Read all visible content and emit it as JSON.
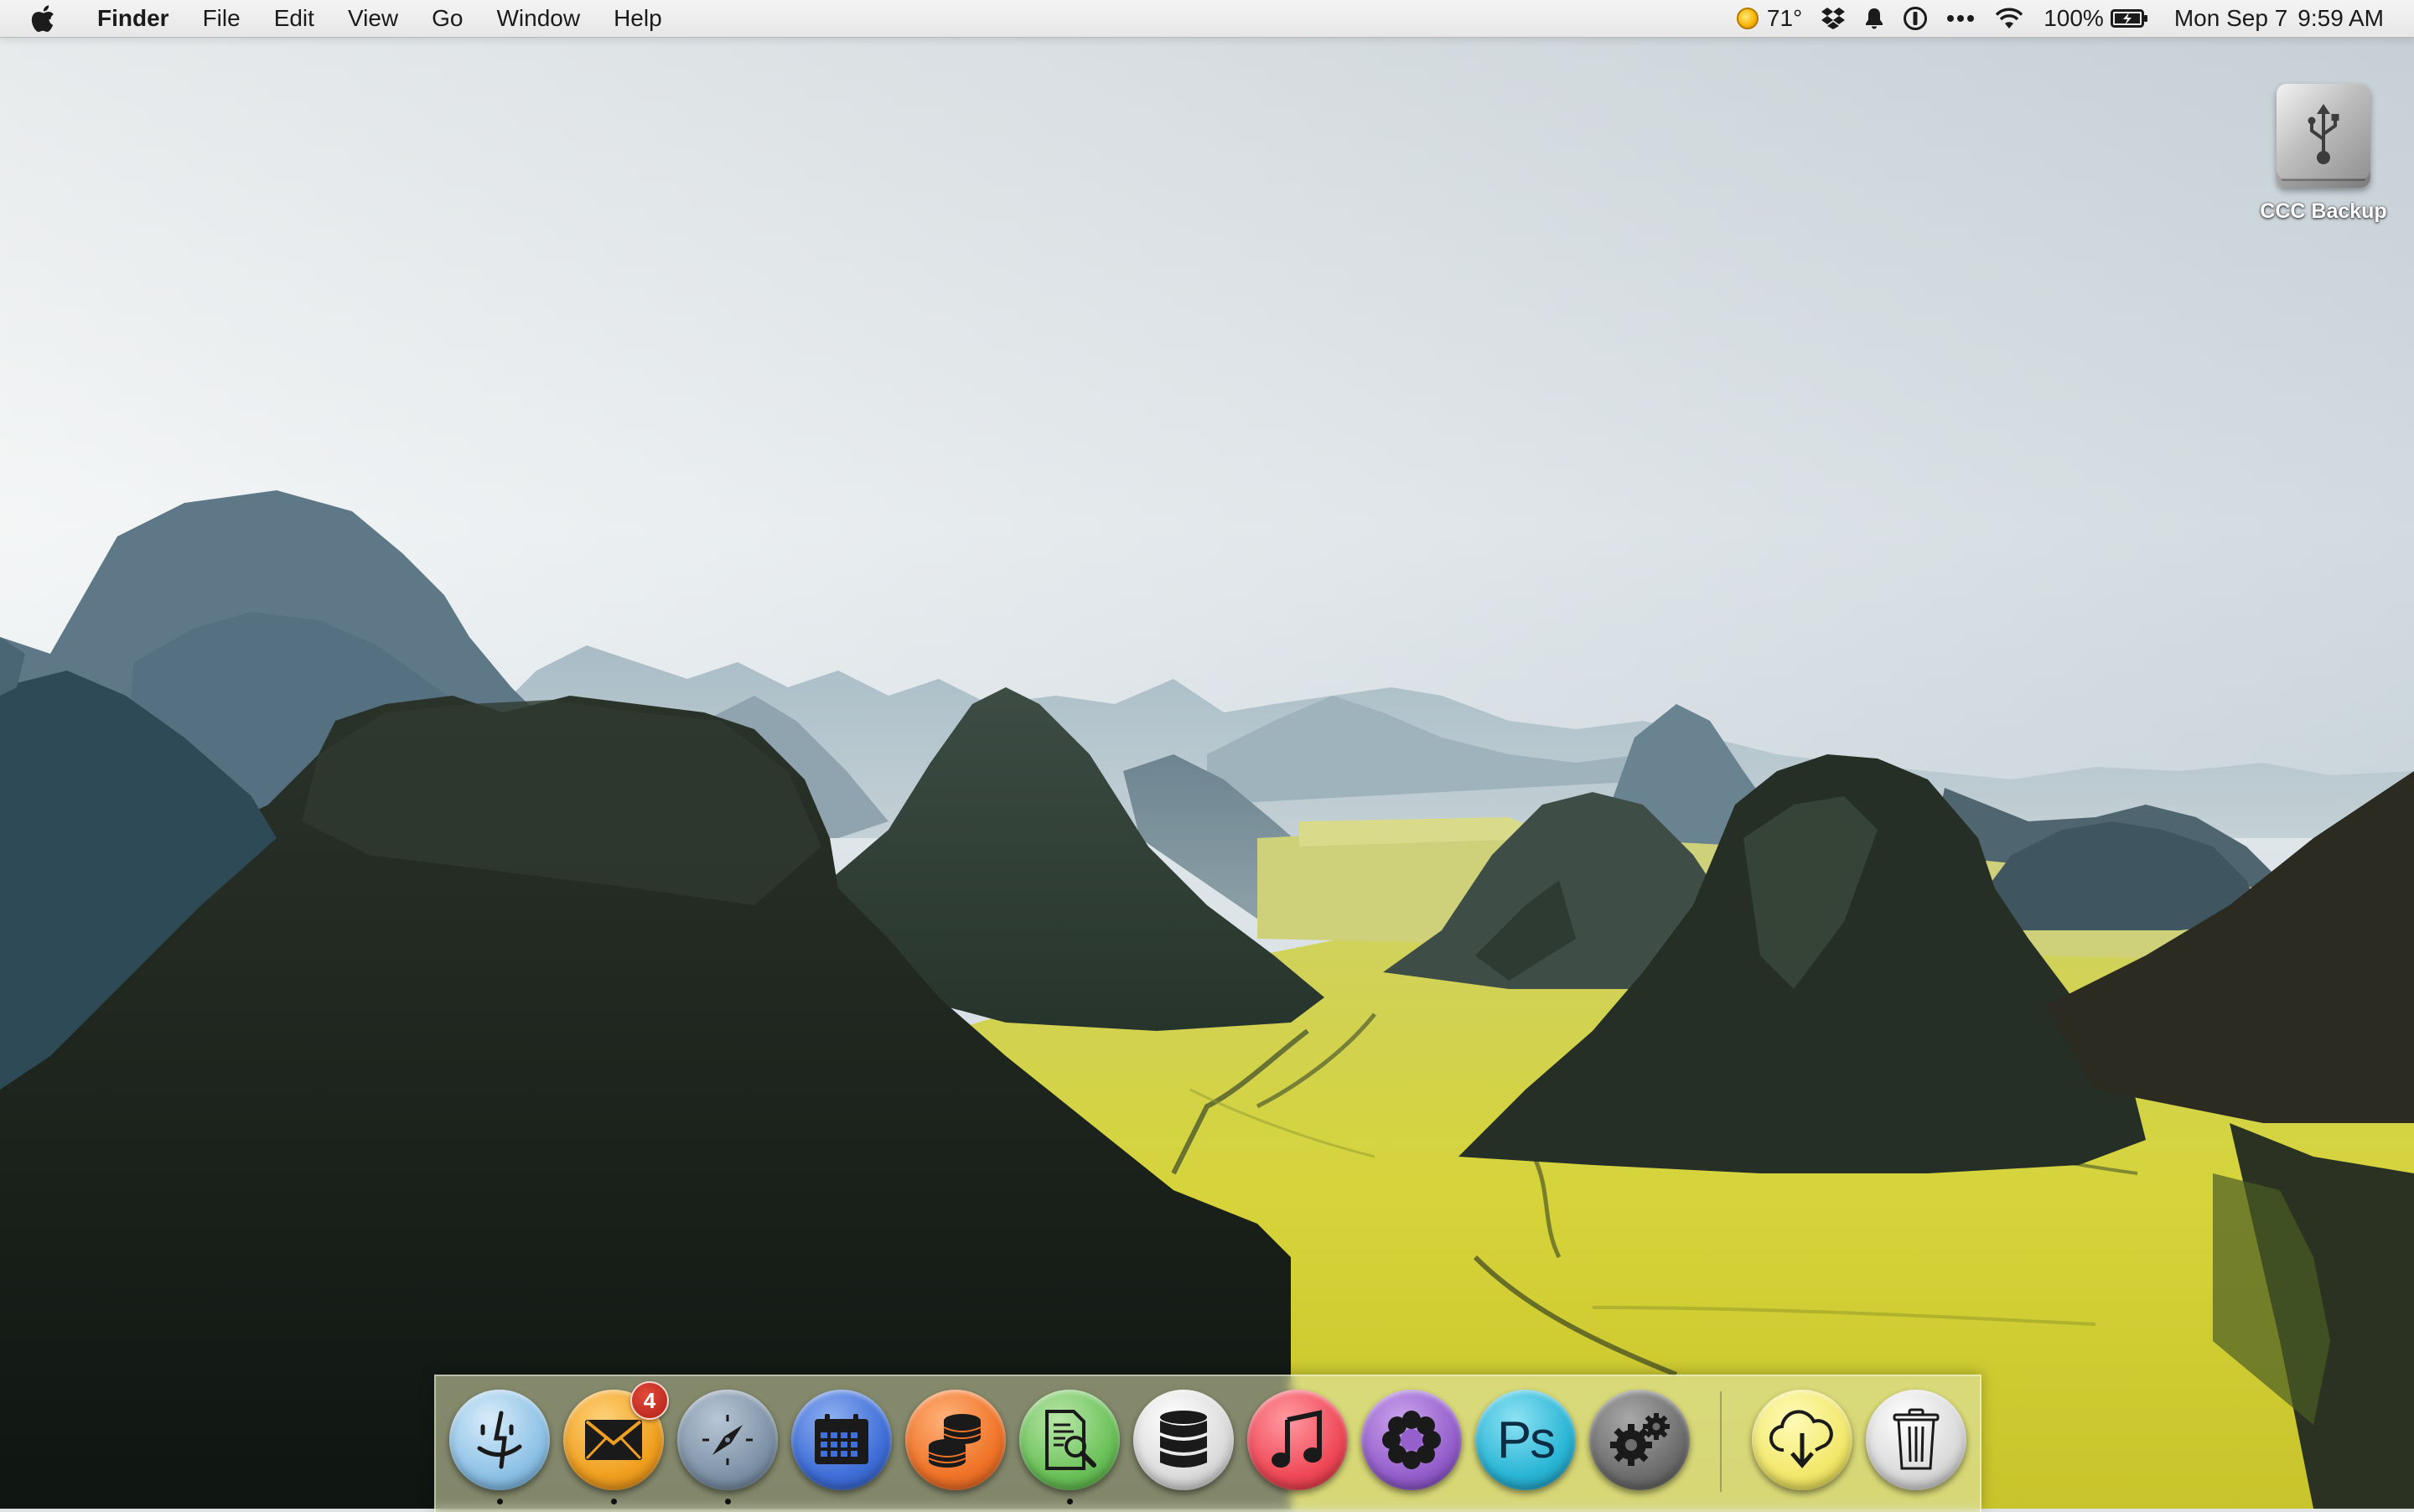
{
  "menubar": {
    "apple_icon": "apple-logo",
    "app_name": "Finder",
    "menus": [
      "File",
      "Edit",
      "View",
      "Go",
      "Window",
      "Help"
    ],
    "status": {
      "weather_icon": "sun-icon",
      "temperature": "71°",
      "battery_percent": "100%",
      "date": "Mon Sep 7",
      "time": "9:59 AM"
    }
  },
  "desktop": {
    "icons": [
      {
        "label": "CCC Backup",
        "icon": "usb-drive-icon"
      }
    ]
  },
  "dock": {
    "apps": [
      {
        "name": "finder",
        "icon": "finder-icon",
        "running": true
      },
      {
        "name": "mail",
        "icon": "mail-icon",
        "running": true,
        "badge": "4"
      },
      {
        "name": "safari",
        "icon": "compass-icon",
        "running": true
      },
      {
        "name": "calendar",
        "icon": "calendar-icon",
        "running": false
      },
      {
        "name": "coins",
        "icon": "coins-icon",
        "running": false
      },
      {
        "name": "preview",
        "icon": "document-search-icon",
        "running": true
      },
      {
        "name": "database",
        "icon": "database-icon",
        "running": false
      },
      {
        "name": "music",
        "icon": "music-note-icon",
        "running": false
      },
      {
        "name": "flower",
        "icon": "flower-icon",
        "running": false
      },
      {
        "name": "photoshop",
        "icon": "photoshop-icon",
        "label": "Ps",
        "running": false
      },
      {
        "name": "system-preferences",
        "icon": "gears-icon",
        "running": false
      }
    ],
    "right": [
      {
        "name": "downloads",
        "icon": "cloud-download-icon"
      },
      {
        "name": "trash",
        "icon": "trash-icon"
      }
    ]
  },
  "colors": {
    "sky": "#e9eef0",
    "mountain_dark": "#1e2620",
    "field_yellow": "#d8d63a",
    "badge_red": "#c2281c"
  }
}
